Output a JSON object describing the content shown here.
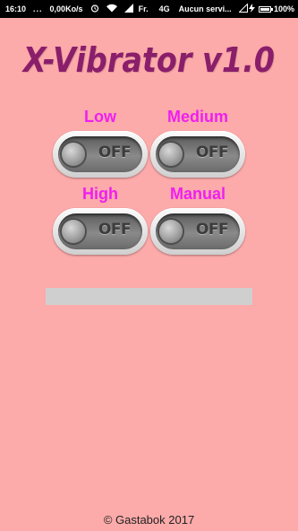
{
  "status_bar": {
    "time": "16:10",
    "dots": "...",
    "net_speed": "0,00Ko/s",
    "alarm_icon": "alarm-clock-icon",
    "wifi_icon": "wifi-icon",
    "signal1_icon": "cell-signal-icon",
    "carrier1": "Fr.",
    "network_type": "4G",
    "carrier2": "Aucun servi...",
    "signal2_icon": "cell-signal-empty-icon",
    "charging_icon": "lightning-icon",
    "battery_percent": "100%",
    "battery_level": 1.0
  },
  "app": {
    "title": "X-Vibrator v1.0",
    "title_color": "#8a1e6b",
    "label_color": "#f01ff0",
    "background_color": "#fcaaaa"
  },
  "modes": [
    {
      "label": "Low",
      "state": "OFF"
    },
    {
      "label": "Medium",
      "state": "OFF"
    },
    {
      "label": "High",
      "state": "OFF"
    },
    {
      "label": "Manual",
      "state": "OFF"
    }
  ],
  "progress": {
    "value": 0
  },
  "footer": {
    "text": "© Gastabok  2017"
  }
}
